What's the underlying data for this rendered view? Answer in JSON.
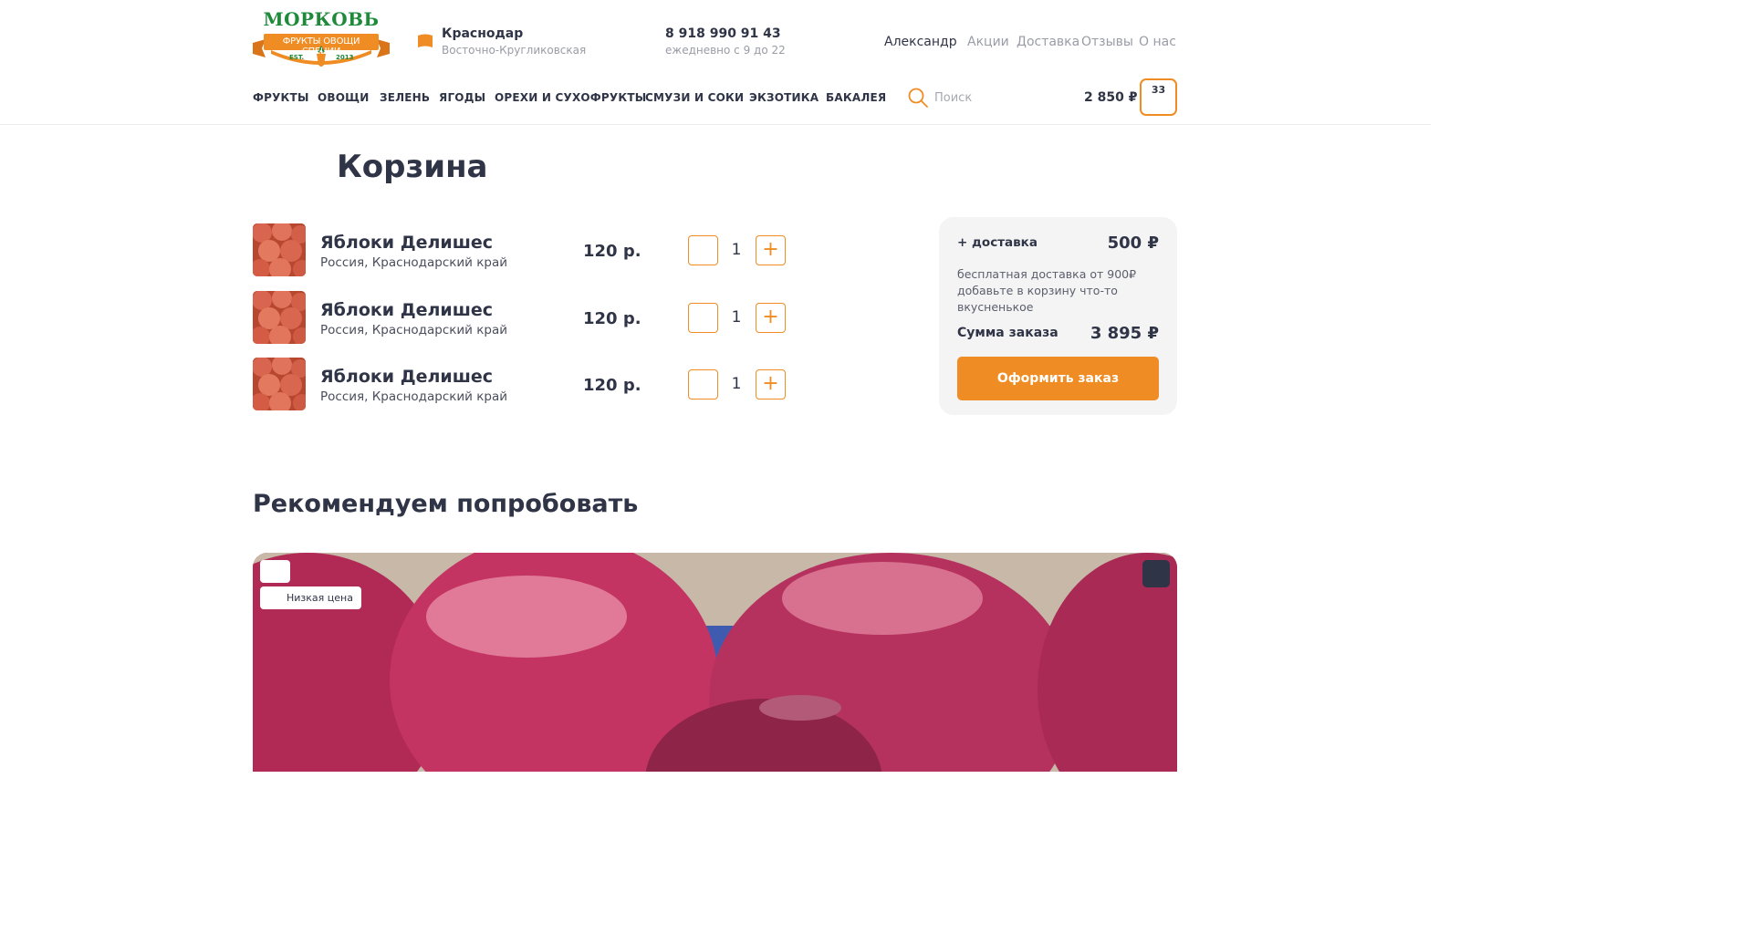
{
  "header": {
    "logo": {
      "title": "МОРКОВЬ",
      "ribbon": "ФРУКТЫ ОВОЩИ СПЕЦИИ",
      "est": "EST.",
      "year": "2013"
    },
    "city": {
      "name": "Краснодар",
      "area": "Восточно-Кругликовская"
    },
    "contact": {
      "phone": "8 918 990 91 43",
      "hours": "ежедневно с 9 до 22"
    },
    "user_name": "Александр",
    "top_links": [
      "Акции",
      "Доставка",
      "Отзывы",
      "О нас"
    ],
    "nav": [
      "ФРУКТЫ",
      "ОВОЩИ",
      "ЗЕЛЕНЬ",
      "ЯГОДЫ",
      "ОРЕХИ И СУХОФРУКТЫ",
      "СМУЗИ И СОКИ",
      "ЭКЗОТИКА",
      "БАКАЛЕЯ"
    ],
    "search": {
      "placeholder": "Поиск",
      "value": ""
    },
    "cart": {
      "sum": "2 850 ₽",
      "count": "33"
    }
  },
  "cart_page": {
    "title": "Корзина",
    "items": [
      {
        "name": "Яблоки Делишес",
        "origin": "Россия, Краснодарский край",
        "price": "120 р.",
        "qty": "1",
        "plus": "+"
      },
      {
        "name": "Яблоки Делишес",
        "origin": "Россия, Краснодарский край",
        "price": "120 р.",
        "qty": "1",
        "plus": "+"
      },
      {
        "name": "Яблоки Делишес",
        "origin": "Россия, Краснодарский край",
        "price": "120 р.",
        "qty": "1",
        "plus": "+"
      }
    ]
  },
  "summary": {
    "delivery_label": "+ доставка",
    "delivery_value": "500 ₽",
    "note": "бесплатная доставка от 900₽ добавьте в корзину что-то вкусненькое",
    "total_label": "Сумма заказа",
    "total_value": "3 895 ₽",
    "order_button": "Оформить заказ"
  },
  "recommend": {
    "title": "Рекомендуем попробовать",
    "badge": "Низкая цена"
  },
  "colors": {
    "accent": "#ef8c23",
    "text": "#2f3446",
    "muted": "#9a9ca6",
    "brand_green": "#1e8a3a"
  }
}
